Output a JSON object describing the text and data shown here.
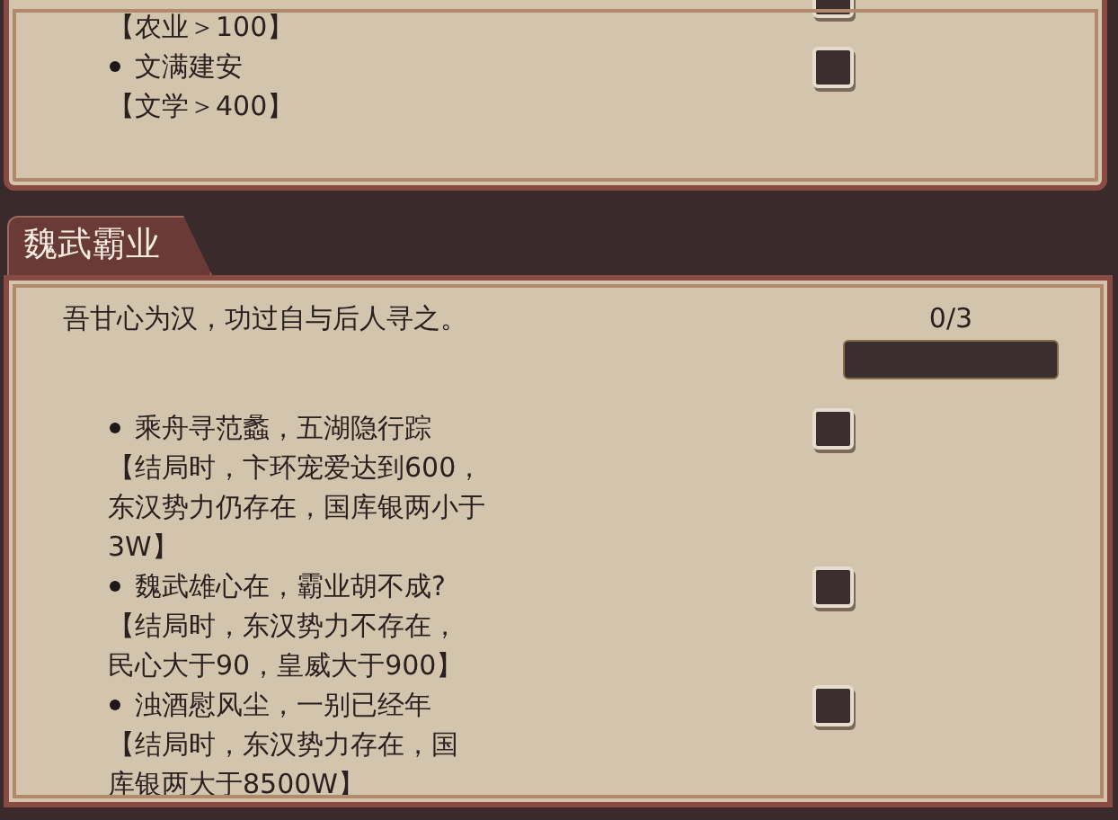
{
  "sections": [
    {
      "items": [
        {
          "condition": [
            "【农业＞100】"
          ],
          "checked": false
        },
        {
          "title": "文满建安",
          "condition": [
            "【文学＞400】"
          ],
          "checked": false
        }
      ]
    },
    {
      "title": "魏武霸业",
      "description": "吾甘心为汉，功过自与后人寻之。",
      "progress": {
        "text": "0/3",
        "level": 0
      },
      "items": [
        {
          "title": "乘舟寻范蠡，五湖隐行踪",
          "condition": [
            "【结局时，卞环宠爱达到600，",
            "东汉势力仍存在，国库银两小于",
            "3W】"
          ],
          "checked": false
        },
        {
          "title": "魏武雄心在，霸业胡不成?",
          "condition": [
            "【结局时，东汉势力不存在，",
            "民心大于90，皇威大于900】"
          ],
          "checked": false
        },
        {
          "title": "浊酒慰风尘，一别已经年",
          "condition": [
            "【结局时，东汉势力存在，国",
            "库银两大于8500W】"
          ],
          "checked": false
        }
      ]
    }
  ]
}
